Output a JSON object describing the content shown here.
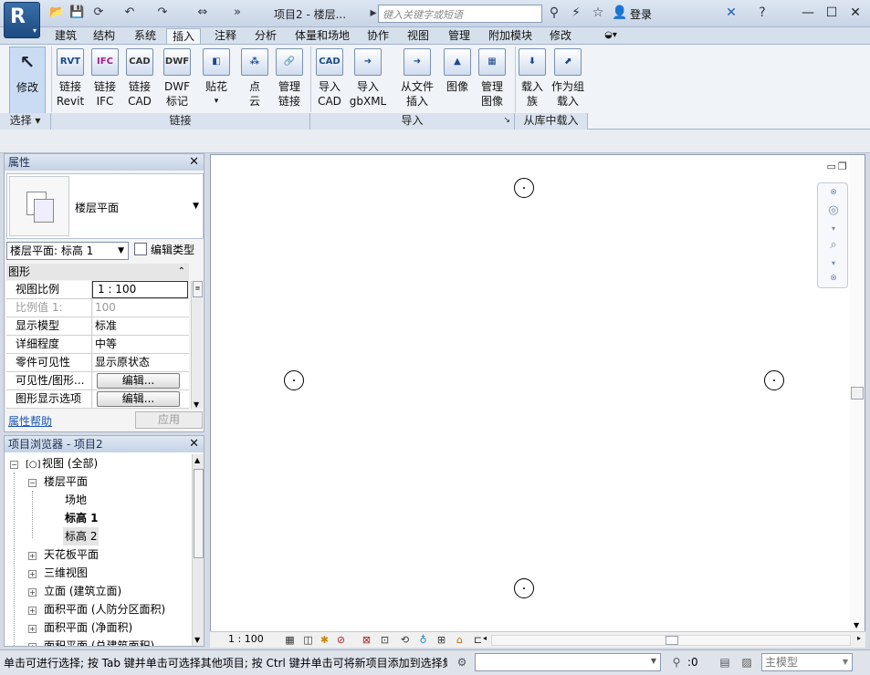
{
  "titlebar": {
    "app_letter": "R",
    "doc_title": "项目2 - 楼层...",
    "search_placeholder": "键入关键字或短语",
    "login": "登录"
  },
  "tabs": [
    "建筑",
    "结构",
    "系统",
    "插入",
    "注释",
    "分析",
    "体量和场地",
    "协作",
    "视图",
    "管理",
    "附加模块",
    "修改"
  ],
  "active_tab": "插入",
  "ribbon": {
    "modify": "修改",
    "buttons": [
      {
        "l1": "链接",
        "l2": "Revit",
        "icon": "RVT"
      },
      {
        "l1": "链接",
        "l2": "IFC",
        "icon": "IFC"
      },
      {
        "l1": "链接",
        "l2": "CAD",
        "icon": "CAD"
      },
      {
        "l1": "DWF",
        "l2": "标记",
        "icon": "DWF"
      },
      {
        "l1": "贴花",
        "l2": "▾",
        "icon": "◧"
      },
      {
        "l1": "点",
        "l2": "云",
        "icon": "⁂"
      },
      {
        "l1": "管理",
        "l2": "链接",
        "icon": "🔗"
      },
      {
        "l1": "导入",
        "l2": "CAD",
        "icon": "CAD"
      },
      {
        "l1": "导入",
        "l2": "gbXML",
        "icon": "➜"
      },
      {
        "l1": "从文件",
        "l2": "插入",
        "icon": "➜"
      },
      {
        "l1": "图像",
        "l2": "",
        "icon": "▲"
      },
      {
        "l1": "管理",
        "l2": "图像",
        "icon": "▦"
      },
      {
        "l1": "载入",
        "l2": "族",
        "icon": "⬇"
      },
      {
        "l1": "作为组",
        "l2": "载入",
        "icon": "⬈"
      }
    ],
    "groups": {
      "select": "选择",
      "link": "链接",
      "import": "导入",
      "load": "从库中载入"
    }
  },
  "properties": {
    "title": "属性",
    "type_name": "楼层平面",
    "view_filter": "楼层平面: 标高 1",
    "edit_type": "编辑类型",
    "category": "图形",
    "rows": [
      {
        "k": "视图比例",
        "v": "1 : 100"
      },
      {
        "k": "比例值 1:",
        "v": "100"
      },
      {
        "k": "显示模型",
        "v": "标准"
      },
      {
        "k": "详细程度",
        "v": "中等"
      },
      {
        "k": "零件可见性",
        "v": "显示原状态"
      },
      {
        "k": "可见性/图形...",
        "v": "编辑..."
      },
      {
        "k": "图形显示选项",
        "v": "编辑..."
      }
    ],
    "help": "属性帮助",
    "apply": "应用"
  },
  "browser": {
    "title": "项目浏览器 - 项目2",
    "nodes": [
      {
        "label": "视图 (全部)"
      },
      {
        "label": "楼层平面"
      },
      {
        "label": "场地"
      },
      {
        "label": "标高 1"
      },
      {
        "label": "标高 2"
      },
      {
        "label": "天花板平面"
      },
      {
        "label": "三维视图"
      },
      {
        "label": "立面 (建筑立面)"
      },
      {
        "label": "面积平面 (人防分区面积)"
      },
      {
        "label": "面积平面 (净面积)"
      },
      {
        "label": "面积平面 (总建筑面积)"
      }
    ]
  },
  "viewbar": {
    "scale": "1 : 100"
  },
  "status": {
    "text": "单击可进行选择; 按 Tab 键并单击可选择其他项目; 按 Ctrl 键并单击可将新项目添加到选择集",
    "sel_count": ":0",
    "model": "主模型"
  }
}
